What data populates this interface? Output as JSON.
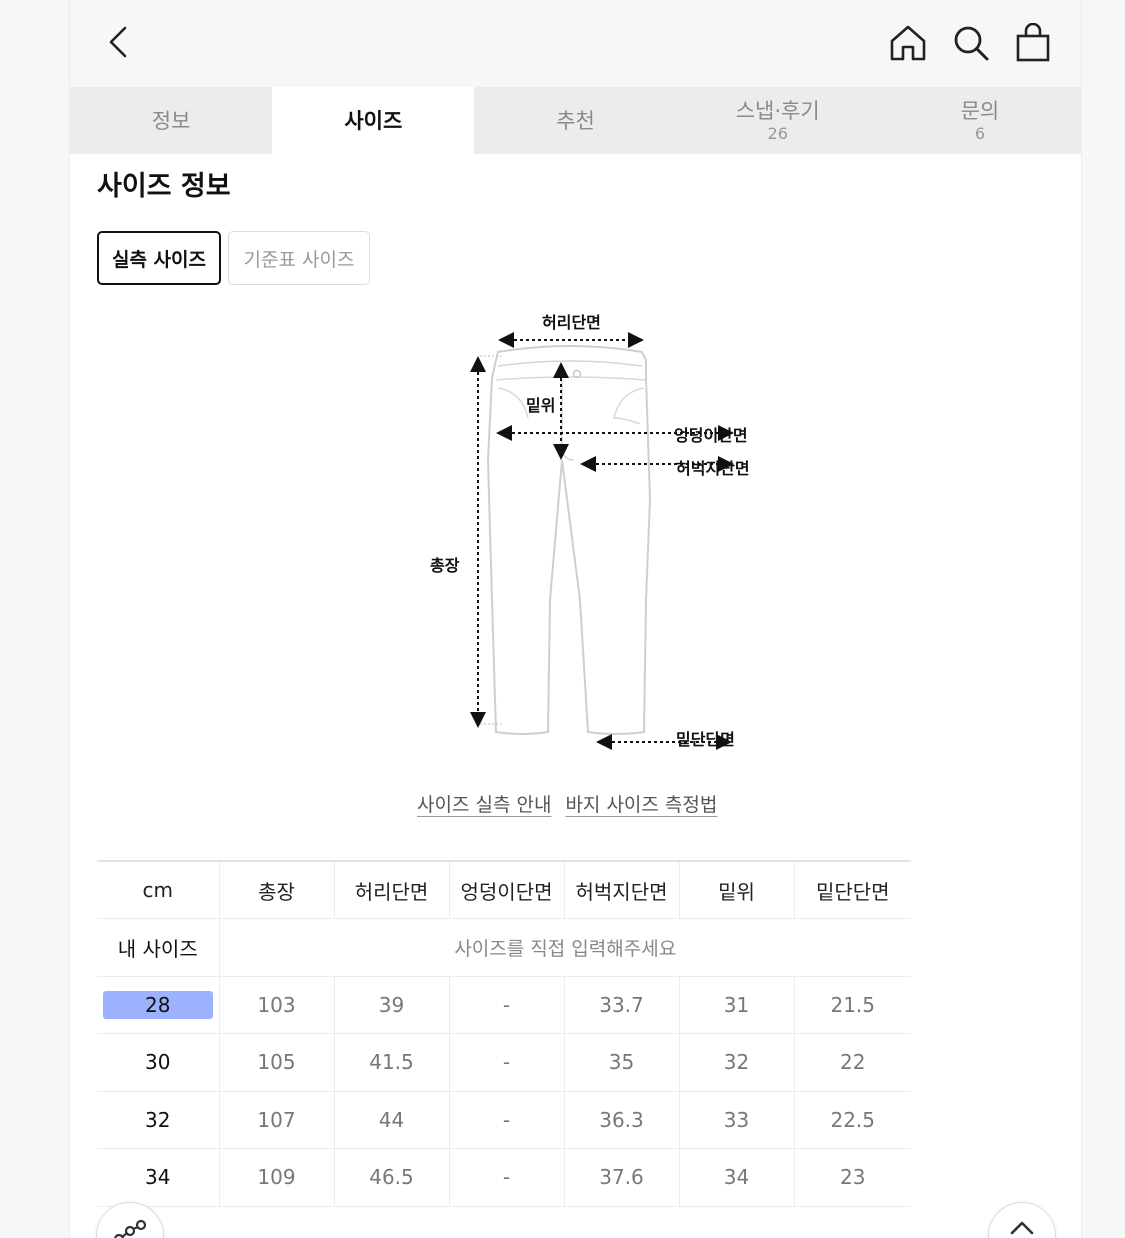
{
  "tabs": [
    {
      "label": "정보",
      "count": ""
    },
    {
      "label": "사이즈",
      "count": ""
    },
    {
      "label": "추천",
      "count": ""
    },
    {
      "label": "스냅·후기",
      "count": "26"
    },
    {
      "label": "문의",
      "count": "6"
    }
  ],
  "section_title": "사이즈 정보",
  "size_toggle": {
    "actual": "실측 사이즈",
    "standard": "기준표 사이즈"
  },
  "diagram": {
    "waist": "허리단면",
    "rise": "밑위",
    "hip": "엉덩이단면",
    "thigh": "허벅지단면",
    "length": "총장",
    "hem": "밑단단면"
  },
  "links": {
    "guide": "사이즈 실측 안내",
    "howto": "바지 사이즈 측정법"
  },
  "table": {
    "headers": [
      "cm",
      "총장",
      "허리단면",
      "엉덩이단면",
      "허벅지단면",
      "밑위",
      "밑단단면"
    ],
    "my_size_label": "내 사이즈",
    "my_size_prompt": "사이즈를 직접 입력해주세요",
    "rows": [
      [
        "28",
        "103",
        "39",
        "-",
        "33.7",
        "31",
        "21.5"
      ],
      [
        "30",
        "105",
        "41.5",
        "-",
        "35",
        "32",
        "22"
      ],
      [
        "32",
        "107",
        "44",
        "-",
        "36.3",
        "33",
        "22.5"
      ],
      [
        "34",
        "109",
        "46.5",
        "-",
        "37.6",
        "34",
        "23"
      ]
    ]
  },
  "colors": {
    "highlight": "#9db2ff",
    "tab_inactive": "#ececec"
  }
}
